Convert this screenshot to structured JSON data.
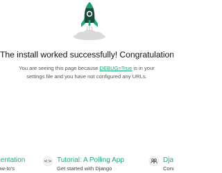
{
  "main": {
    "headline": "The install worked successfully! Congratulations!",
    "body_before_link": "You are seeing this page because ",
    "body_link": "DEBUG=True",
    "body_after_link": " is in your settings file and you have not configured any URLs."
  },
  "cards": [
    {
      "title": "Documentation",
      "subtitle": "Topics, references, & how-to's",
      "icon": "book-icon"
    },
    {
      "title": "Tutorial: A Polling App",
      "subtitle": "Get started with Django",
      "icon": "code-icon",
      "glyph": "<>"
    },
    {
      "title": "Django Community",
      "subtitle": "Connect, get help, or contribute",
      "icon": "people-icon"
    }
  ],
  "colors": {
    "accent": "#20aa76",
    "rocket_body": "#1a4a3a",
    "rocket_fin": "#20aa76",
    "cloud": "#d9d9d9",
    "headline": "#111111",
    "body_text": "#555555"
  }
}
